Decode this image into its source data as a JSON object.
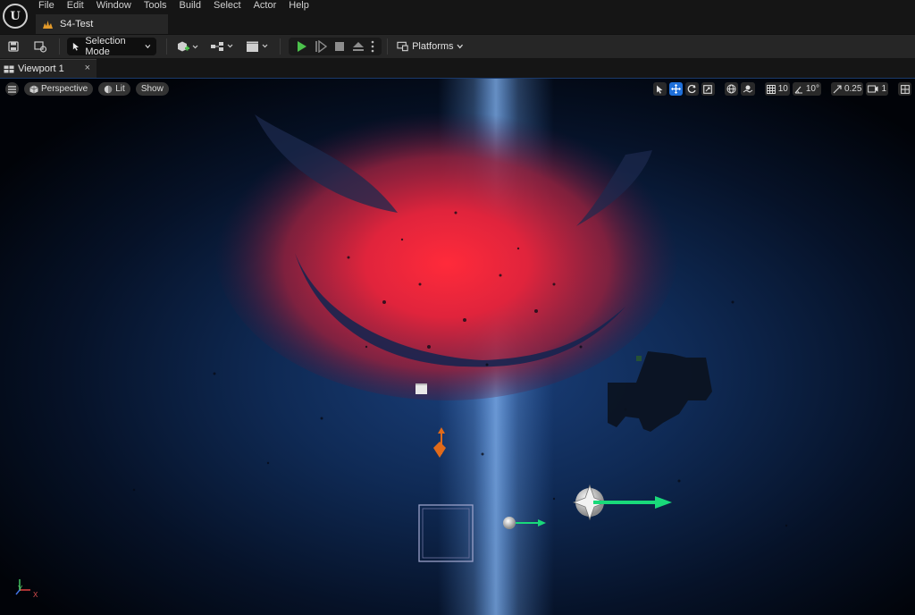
{
  "app": {
    "logo_letter": "U"
  },
  "menu": {
    "items": [
      "File",
      "Edit",
      "Window",
      "Tools",
      "Build",
      "Select",
      "Actor",
      "Help"
    ]
  },
  "project_tab": {
    "label": "S4-Test"
  },
  "toolbar": {
    "mode_label": "Selection Mode",
    "platforms_label": "Platforms"
  },
  "viewport_tab": {
    "label": "Viewport 1",
    "close": "×"
  },
  "viewport_toolbar": {
    "view_mode": "Perspective",
    "lighting": "Lit",
    "show": "Show",
    "grid_snap": "10",
    "rotation_snap": "10°",
    "scale_snap": "0.25",
    "camera_speed": "1"
  },
  "axis_indicator": {
    "x": "X",
    "y": "Y"
  },
  "colors": {
    "accent": "#1f6fd8",
    "play_green": "#4cc24c",
    "gizmo_green": "#19d97a",
    "gizmo_orange": "#e06a1a",
    "red_glow": "#ff2a3a"
  },
  "icons": [
    "unreal-logo-icon",
    "save-icon",
    "browse-content-icon",
    "selection-mode-icon",
    "add-actor-icon",
    "blueprint-icon",
    "cinematics-icon",
    "play-icon",
    "advance-frame-icon",
    "stop-icon",
    "eject-icon",
    "more-options-icon",
    "platforms-icon",
    "viewport-layout-icon",
    "hamburger-icon",
    "perspective-cube-icon",
    "lit-sphere-icon",
    "select-tool-icon",
    "translate-tool-icon",
    "rotate-tool-icon",
    "scale-tool-icon",
    "world-coordinates-icon",
    "surface-snap-icon",
    "grid-snap-icon",
    "rotation-snap-icon",
    "scale-snap-icon",
    "camera-speed-icon",
    "maximize-viewport-icon"
  ]
}
